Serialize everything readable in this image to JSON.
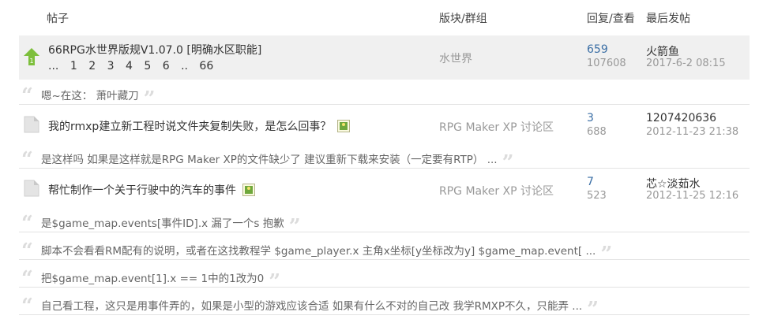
{
  "header": {
    "col_topic": "帖子",
    "col_forum": "版块/群组",
    "col_replies": "回复/查看",
    "col_lastpost": "最后发帖"
  },
  "sticky": {
    "title": "66RPG水世界版规V1.07.0 [明确水区职能]",
    "pages": [
      "...",
      "1",
      "2",
      "3",
      "4",
      "5",
      "6",
      "..",
      "66"
    ],
    "icon_label": "1",
    "forum": "水世界",
    "replies": "659",
    "views": "107608",
    "last_user": "火箭鱼",
    "last_time": "2017-6-2 08:15"
  },
  "quote1": {
    "text": "嗯~在这： 萧叶藏刀"
  },
  "thread1": {
    "title": "我的rmxp建立新工程时说文件夹复制失败，是怎么回事？",
    "forum": "RPG Maker XP 讨论区",
    "replies": "3",
    "views": "688",
    "last_user": "1207420636",
    "last_time": "2012-11-23 21:38"
  },
  "quote2": {
    "text": "是这样吗 如果是这样就是RPG Maker XP的文件缺少了 建议重新下载来安装（一定要有RTP） ..."
  },
  "thread2": {
    "title": "帮忙制作一个关于行驶中的汽车的事件",
    "forum": "RPG Maker XP 讨论区",
    "replies": "7",
    "views": "523",
    "last_user": "芯☆淡茹水",
    "last_time": "2012-11-25 12:16"
  },
  "quote3": {
    "text": "是$game_map.events[事件ID].x 漏了一个s 抱歉"
  },
  "quote4": {
    "text": "脚本不会看看RM配有的说明，或者在这找教程学 $game_player.x 主角x坐标[y坐标改为y] $game_map.event[ ..."
  },
  "quote5": {
    "text": "把$game_map.event[1].x == 1中的1改为0"
  },
  "quote6": {
    "text": "自己看工程，这只是用事件弄的，如果是小型的游戏应该合适 如果有什么不对的自己改 我学RMXP不久，只能弄 ..."
  },
  "quote_marks": {
    "open": "“",
    "close": "”"
  },
  "colors": {
    "sticky_bg": "#f0f0f0",
    "link_blue": "#3a6ea5",
    "muted": "#999999",
    "up_arrow": "#7dbf3c"
  },
  "icons": {
    "sticky": "arrow-up-icon",
    "thread": "document-icon",
    "attachment": "image-attachment-icon",
    "quote": "quote-mark-icon"
  }
}
